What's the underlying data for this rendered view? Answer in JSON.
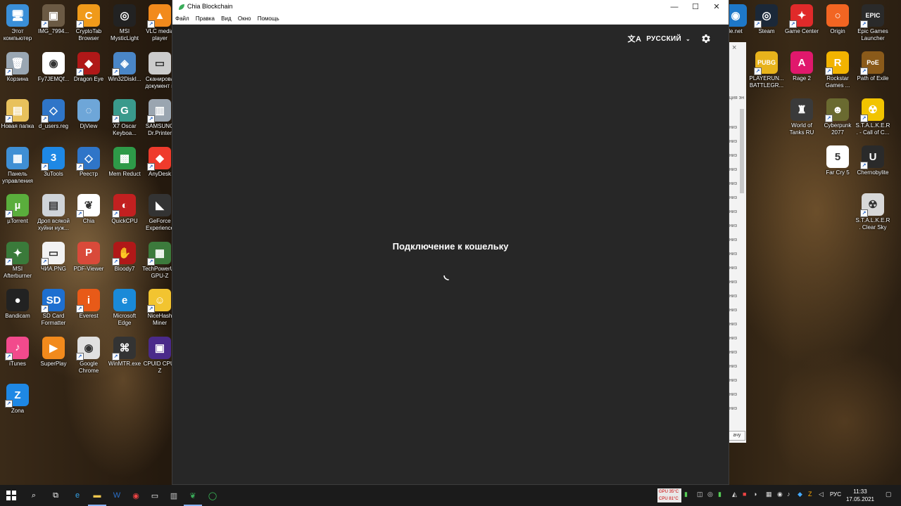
{
  "desktop": {
    "left_icons": [
      {
        "label": "Этот компьютер",
        "color": "#3a8fd8",
        "glyph": "🖥"
      },
      {
        "label": "IMG_7994...",
        "color": "#6b5a44",
        "glyph": "▣"
      },
      {
        "label": "CryptoTab Browser",
        "color": "#f09a1a",
        "glyph": "C"
      },
      {
        "label": "MSI MysticLight",
        "color": "#222222",
        "glyph": "◎"
      },
      {
        "label": "VLC media player",
        "color": "#f28a1c",
        "glyph": "▲"
      },
      {
        "label": "Корзина",
        "color": "#9aa7b3",
        "glyph": "🗑"
      },
      {
        "label": "Fy7JEMQf...",
        "color": "#ffffff",
        "glyph": "◉"
      },
      {
        "label": "Dragon Eye",
        "color": "#b01818",
        "glyph": "◆"
      },
      {
        "label": "Win32DiskI...",
        "color": "#4a86c7",
        "glyph": "◈"
      },
      {
        "label": "Сканирова документ и",
        "color": "#cccccc",
        "glyph": "▭"
      },
      {
        "label": "Новая папка",
        "color": "#e8c15c",
        "glyph": "▤"
      },
      {
        "label": "d_users.reg",
        "color": "#2f75c8",
        "glyph": "◇"
      },
      {
        "label": "DjView",
        "color": "#6ea6d8",
        "glyph": "◌"
      },
      {
        "label": "X7 Oscar Keyboa...",
        "color": "#3a9a8c",
        "glyph": "G"
      },
      {
        "label": "SAMSUNG Dr.Printer",
        "color": "#9aa5b0",
        "glyph": "▥"
      },
      {
        "label": "Панель управления",
        "color": "#3f8fd4",
        "glyph": "▦"
      },
      {
        "label": "3uTools",
        "color": "#1e88e5",
        "glyph": "3"
      },
      {
        "label": "Реестр",
        "color": "#2f75c8",
        "glyph": "◇"
      },
      {
        "label": "Mem Reduct",
        "color": "#2e9a48",
        "glyph": "▩"
      },
      {
        "label": "AnyDesk",
        "color": "#ef3b2c",
        "glyph": "◆"
      },
      {
        "label": "µTorrent",
        "color": "#5aae3c",
        "glyph": "µ"
      },
      {
        "label": "Дроп всякой хуйни нуж...",
        "color": "#d0d4d8",
        "glyph": "▤"
      },
      {
        "label": "Chia",
        "color": "#ffffff",
        "glyph": "❦"
      },
      {
        "label": "QuickCPU",
        "color": "#c22020",
        "glyph": "◐"
      },
      {
        "label": "GeForce Experience",
        "color": "#333333",
        "glyph": "◣"
      },
      {
        "label": "MSI Afterburner",
        "color": "#3a7a3a",
        "glyph": "✦"
      },
      {
        "label": "ЧИА.PNG",
        "color": "#f2f2f2",
        "glyph": "▭"
      },
      {
        "label": "PDF-Viewer",
        "color": "#d94a3a",
        "glyph": "P"
      },
      {
        "label": "Bloody7",
        "color": "#b01818",
        "glyph": "✋"
      },
      {
        "label": "TechPowerUp GPU-Z",
        "color": "#3c7a3c",
        "glyph": "▦"
      },
      {
        "label": "Bandicam",
        "color": "#222222",
        "glyph": "●"
      },
      {
        "label": "SD Card Formatter",
        "color": "#1e6fd0",
        "glyph": "SD"
      },
      {
        "label": "Everest",
        "color": "#e85a18",
        "glyph": "i"
      },
      {
        "label": "Microsoft Edge",
        "color": "#1a8ad8",
        "glyph": "e"
      },
      {
        "label": "NiceHash Miner",
        "color": "#f2c430",
        "glyph": "☺"
      },
      {
        "label": "iTunes",
        "color": "#f24a8c",
        "glyph": "♪"
      },
      {
        "label": "SuperPlay",
        "color": "#f28a1c",
        "glyph": "▶"
      },
      {
        "label": "Google Chrome",
        "color": "#e0e0e0",
        "glyph": "◉"
      },
      {
        "label": "WinMTR.exe",
        "color": "#333333",
        "glyph": "⌘"
      },
      {
        "label": "CPUID CPU-Z",
        "color": "#4a2a8a",
        "glyph": "▣"
      },
      {
        "label": "Zona",
        "color": "#1e88e5",
        "glyph": "Z"
      }
    ],
    "right_icons": [
      {
        "label": "le.net",
        "color": "#1e78c8",
        "glyph": "◉"
      },
      {
        "label": "Steam",
        "color": "#1b2838",
        "glyph": "◎"
      },
      {
        "label": "Game Center",
        "color": "#e02a2a",
        "glyph": "✦"
      },
      {
        "label": "Origin",
        "color": "#f26522",
        "glyph": "○"
      },
      {
        "label": "Epic Games Launcher",
        "color": "#2a2a2a",
        "glyph": "EPIC"
      },
      {
        "label": "PLAYERUN... BATTLEGR...",
        "color": "#e8b31c",
        "glyph": "PUBG"
      },
      {
        "label": "Rage 2",
        "color": "#e0186c",
        "glyph": "A"
      },
      {
        "label": "Rockstar Games ...",
        "color": "#f2b300",
        "glyph": "R"
      },
      {
        "label": "Path of Exile",
        "color": "#8a5a1a",
        "glyph": "PoE"
      },
      {
        "label": "World of Tanks RU",
        "color": "#3a3a3a",
        "glyph": "♜"
      },
      {
        "label": "Cyberpunk 2077",
        "color": "#6a6a30",
        "glyph": "☻"
      },
      {
        "label": "S.T.A.L.K.E.R. - Call of C...",
        "color": "#f2c400",
        "glyph": "☢"
      },
      {
        "label": "Far Cry 5",
        "color": "#ffffff",
        "glyph": "5"
      },
      {
        "label": "Chernobylite",
        "color": "#2a2a2a",
        "glyph": "U"
      },
      {
        "label": "S.T.A.L.K.E.R. Clear Sky",
        "color": "#d8d8d8",
        "glyph": "☢"
      }
    ]
  },
  "background_window": {
    "close": "×",
    "rows": [
      "ция эн",
      "низ",
      "низ",
      "низ",
      "низ",
      "низ",
      "низ",
      "низ",
      "низ",
      "низ",
      "низ",
      "низ",
      "низ",
      "низ",
      "низ",
      "низ",
      "низ",
      "низ",
      "низ",
      "низ",
      "низ",
      "низ"
    ],
    "button": "ачу"
  },
  "window": {
    "title": "Chia Blockchain",
    "menu": [
      "Файл",
      "Правка",
      "Вид",
      "Окно",
      "Помощь"
    ],
    "controls": {
      "minimize": "—",
      "maximize": "☐",
      "close": "✕"
    },
    "language": {
      "label": "РУССКИЙ",
      "icon": "translate-icon"
    },
    "status_text": "Подключение к кошельку",
    "accent": "#3aac59"
  },
  "taskbar": {
    "apps": [
      "start",
      "search",
      "task-view",
      "edge",
      "explorer",
      "word",
      "chrome",
      "terminal",
      "folder",
      "chia",
      "whatsapp"
    ],
    "monitor": {
      "line1": "GPU 35°C",
      "line2": "CPU 81°C"
    },
    "keyboard_layout": "РУС",
    "time": "11:33",
    "date": "17.05.2021"
  }
}
